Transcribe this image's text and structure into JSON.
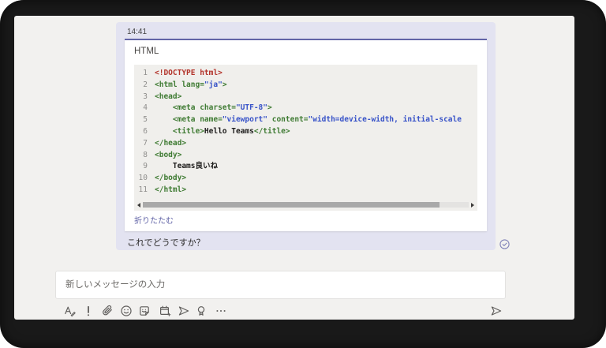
{
  "message": {
    "timestamp": "14:41",
    "text": "これでどうですか？",
    "read_receipt_icon": "check-circle",
    "card": {
      "title": "HTML",
      "collapse_label": "折りたたむ",
      "code_lines": [
        {
          "n": "1",
          "seg": [
            [
              "r",
              "<!DOCTYPE html>"
            ]
          ]
        },
        {
          "n": "2",
          "seg": [
            [
              "g",
              "<html lang="
            ],
            [
              "b",
              "\"ja\""
            ],
            [
              "g",
              ">"
            ]
          ]
        },
        {
          "n": "3",
          "seg": [
            [
              "g",
              "<head>"
            ]
          ]
        },
        {
          "n": "4",
          "seg": [
            [
              "g",
              "    <meta charset="
            ],
            [
              "b",
              "\"UTF-8\""
            ],
            [
              "g",
              ">"
            ]
          ]
        },
        {
          "n": "5",
          "seg": [
            [
              "g",
              "    <meta name="
            ],
            [
              "b",
              "\"viewport\""
            ],
            [
              "g",
              " content="
            ],
            [
              "b",
              "\"width=device-width, initial-scale"
            ]
          ]
        },
        {
          "n": "6",
          "seg": [
            [
              "g",
              "    <title>"
            ],
            [
              "k",
              "Hello Teams"
            ],
            [
              "g",
              "</title>"
            ]
          ]
        },
        {
          "n": "7",
          "seg": [
            [
              "g",
              "</head>"
            ]
          ]
        },
        {
          "n": "8",
          "seg": [
            [
              "g",
              "<body>"
            ]
          ]
        },
        {
          "n": "9",
          "seg": [
            [
              "k",
              "    Teams良いね"
            ]
          ]
        },
        {
          "n": "10",
          "seg": [
            [
              "g",
              "</body>"
            ]
          ]
        },
        {
          "n": "11",
          "seg": [
            [
              "g",
              "</html>"
            ]
          ]
        }
      ],
      "scrollbar": {
        "orientation": "horizontal",
        "thumb_percent": 91
      }
    }
  },
  "compose": {
    "placeholder": "新しいメッセージの入力",
    "toolbar_icons": [
      "format",
      "priority",
      "attach",
      "emoji",
      "sticker",
      "schedule",
      "stream",
      "praise",
      "more"
    ],
    "send_icon": "paper-plane"
  },
  "colors": {
    "frame": "#191919",
    "app_background": "#f2f1ef",
    "bubble": "#e3e3f1",
    "accent_purple": "#6264a7",
    "code_background": "#f0efec",
    "token_red": "#b3342b",
    "token_green": "#3f7b33",
    "token_blue": "#3853c8"
  }
}
